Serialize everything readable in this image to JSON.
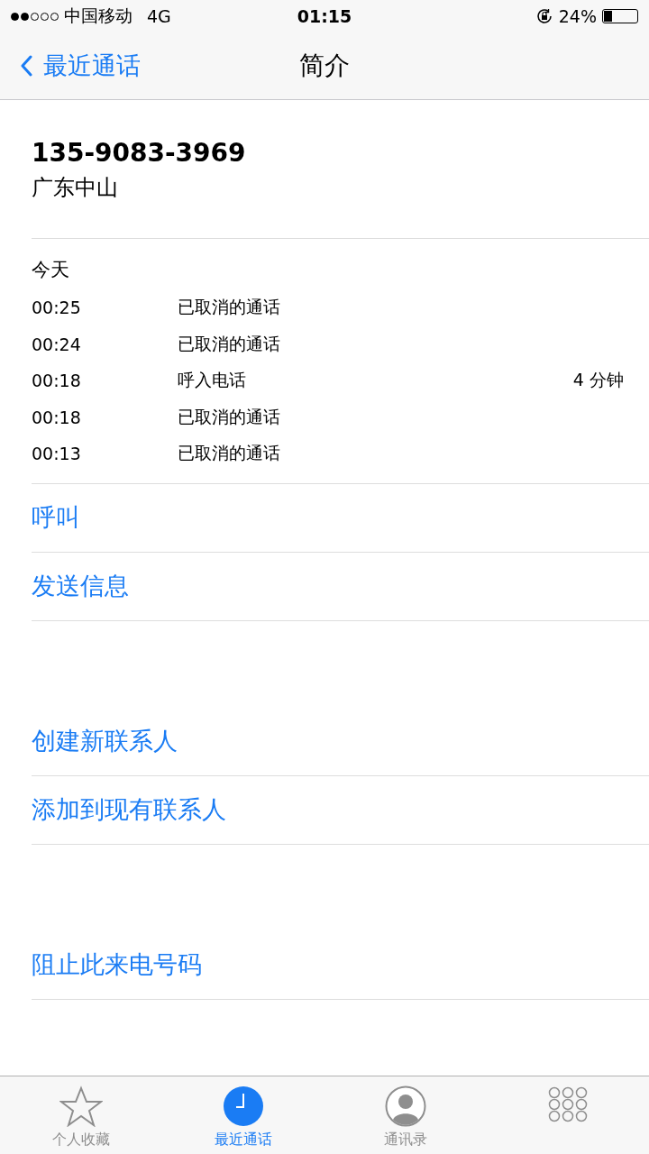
{
  "status_bar": {
    "carrier": "中国移动",
    "network": "4G",
    "time": "01:15",
    "battery_text": "24%"
  },
  "nav": {
    "back_label": "最近通话",
    "title": "简介"
  },
  "contact": {
    "number": "135-9083-3969",
    "location": "广东中山"
  },
  "history": {
    "heading": "今天",
    "calls": [
      {
        "time": "00:25",
        "type": "已取消的通话"
      },
      {
        "time": "00:24",
        "type": "已取消的通话"
      },
      {
        "time": "00:18",
        "type": "呼入电话",
        "duration": "4 分钟"
      },
      {
        "time": "00:18",
        "type": "已取消的通话"
      },
      {
        "time": "00:13",
        "type": "已取消的通话"
      }
    ]
  },
  "action_groups": [
    [
      "呼叫",
      "发送信息"
    ],
    [
      "创建新联系人",
      "添加到现有联系人"
    ],
    [
      "阻止此来电号码"
    ]
  ],
  "tab_bar": [
    {
      "kind": "star",
      "label": "个人收藏",
      "selected": false
    },
    {
      "kind": "clock",
      "label": "最近通话",
      "selected": true
    },
    {
      "kind": "person",
      "label": "通讯录",
      "selected": false
    },
    {
      "kind": "keypad",
      "selected": false
    }
  ]
}
